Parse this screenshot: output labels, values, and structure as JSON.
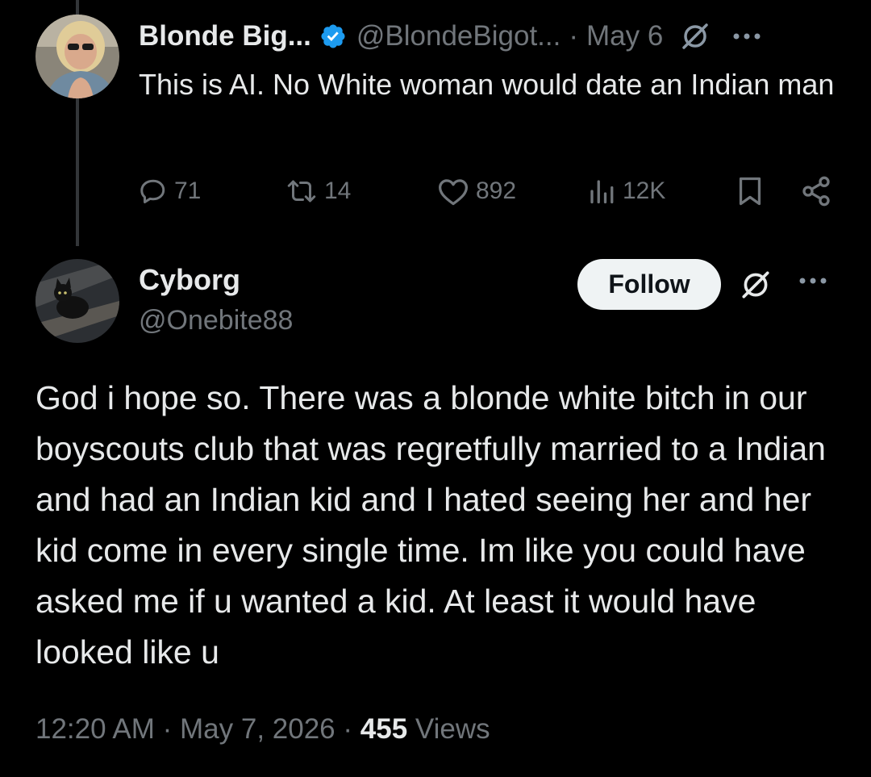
{
  "parent_tweet": {
    "display_name": "Blonde Big...",
    "handle": "@BlondeBigot...",
    "separator": "·",
    "date": "May 6",
    "text": "This is AI. No White woman would date an Indian man",
    "stats": {
      "replies": "71",
      "reposts": "14",
      "likes": "892",
      "views": "12K"
    }
  },
  "reply_tweet": {
    "display_name": "Cyborg",
    "handle": "@Onebite88",
    "follow_label": "Follow",
    "text": "God i hope so. There was a blonde white bitch in our boyscouts club that was regretfully married to a Indian and had an Indian kid and I hated seeing her and her kid come in every single time. Im like you could have asked me if u wanted a kid. At least it would have looked like u",
    "time": "12:20 AM",
    "separator": "·",
    "date": "May 7, 2026",
    "views_count": "455",
    "views_label": "Views"
  },
  "colors": {
    "background": "#000000",
    "primary_text": "#e7e9ea",
    "secondary_text": "#71767b",
    "verified_badge": "#1d9bf0",
    "follow_button_bg": "#eff3f4"
  },
  "icons": {
    "verified": "verified-badge-icon",
    "grok": "grok-icon",
    "more": "more-dots-icon",
    "reply": "reply-bubble-icon",
    "repost": "repost-arrows-icon",
    "like": "heart-icon",
    "views": "bar-chart-icon",
    "bookmark": "bookmark-icon",
    "share": "share-nodes-icon"
  }
}
